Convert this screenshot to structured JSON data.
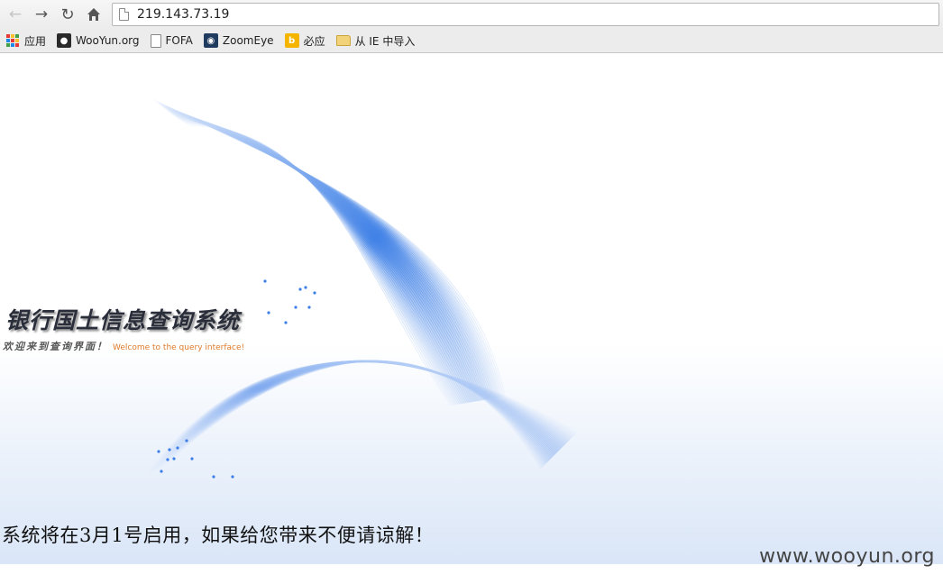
{
  "browser": {
    "url": "219.143.73.19",
    "bookmarks": [
      {
        "label": "应用",
        "icon": "apps-grid-icon"
      },
      {
        "label": "WooYun.org",
        "icon": "wooyun-icon"
      },
      {
        "label": "FOFA",
        "icon": "page-icon"
      },
      {
        "label": "ZoomEye",
        "icon": "zoomeye-eye-icon"
      },
      {
        "label": "必应",
        "icon": "bing-icon"
      },
      {
        "label": "从 IE 中导入",
        "icon": "folder-icon"
      }
    ]
  },
  "page": {
    "title": "银行国土信息查询系统",
    "subtitle_cn": "欢迎来到查询界面！",
    "subtitle_en": "Welcome to the query interface!",
    "notice": "系统将在3月1号启用，如果给您带来不便请谅解！"
  },
  "watermark": "www.wooyun.org",
  "colors": {
    "swirl_blue": "#3d7fe6",
    "subtitle_en": "#e07b2a",
    "bottom_band": "#dae6f8"
  }
}
